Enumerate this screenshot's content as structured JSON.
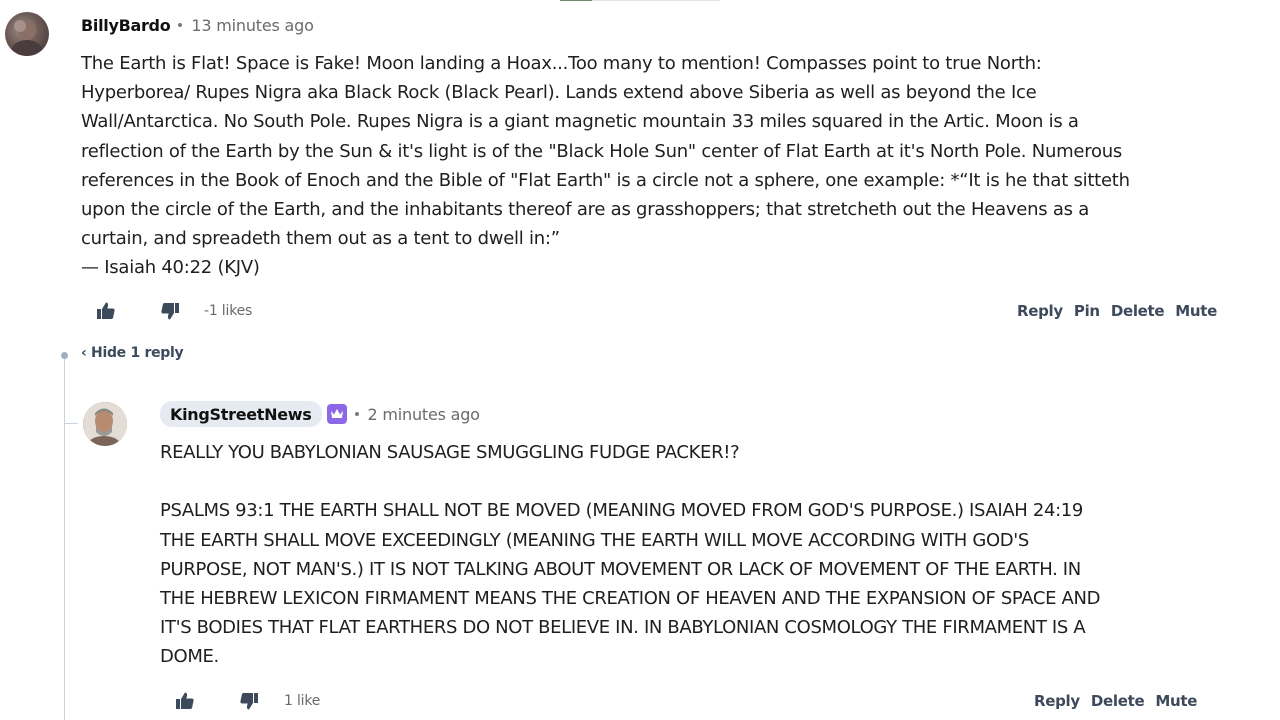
{
  "comments": [
    {
      "author": "BillyBardo",
      "time": "13 minutes ago",
      "body_lines": [
        "The Earth is Flat! Space is Fake! Moon landing a Hoax...Too many to mention! Compasses point to true North:",
        "Hyperborea/ Rupes Nigra aka Black Rock (Black Pearl). Lands extend above Siberia as well as beyond the Ice",
        "Wall/Antarctica. No South Pole. Rupes Nigra is a giant magnetic mountain 33 miles squared in the Artic. Moon is a",
        "reflection of the Earth by the Sun & it's light is of the \"Black Hole Sun\" center of Flat Earth at it's North Pole. Numerous",
        "references in the Book of Enoch and the Bible of \"Flat Earth\" is a circle not a sphere, one example: *“It is he that sitteth",
        "upon the circle of the Earth, and the inhabitants thereof are as grasshoppers; that stretcheth out the Heavens as a",
        "curtain, and spreadeth them out as a tent to dwell in:”",
        "— Isaiah 40:22 (KJV)"
      ],
      "likes": "-1 likes",
      "actions": [
        "Reply",
        "Pin",
        "Delete",
        "Mute"
      ]
    },
    {
      "author": "KingStreetNews",
      "time": "2 minutes ago",
      "badge_icon": "crown-icon",
      "badge_color": "#8c68e6",
      "body_lines": [
        "REALLY YOU BABYLONIAN SAUSAGE SMUGGLING FUDGE PACKER!?",
        "",
        "PSALMS 93:1 THE EARTH SHALL NOT BE MOVED (MEANING MOVED FROM GOD'S PURPOSE.) ISAIAH 24:19",
        "THE EARTH SHALL MOVE EXCEEDINGLY (MEANING THE EARTH WILL MOVE ACCORDING WITH GOD'S",
        "PURPOSE, NOT MAN'S.) IT IS NOT TALKING ABOUT MOVEMENT OR LACK OF MOVEMENT OF THE EARTH. IN",
        "THE HEBREW LEXICON FIRMAMENT MEANS THE CREATION OF HEAVEN AND THE EXPANSION OF SPACE AND",
        "IT'S BODIES THAT FLAT EARTHERS DO NOT BELIEVE IN. IN BABYLONIAN COSMOLOGY THE FIRMAMENT IS A",
        "DOME."
      ],
      "likes": "1 like",
      "actions": [
        "Reply",
        "Delete",
        "Mute"
      ]
    }
  ],
  "replies_toggle": "‹ Hide 1 reply",
  "colors": {
    "action_text": "#3d4a5c",
    "muted_text": "#6b6b6b",
    "thread_line": "#c9d3de",
    "author_pill": "#e6ebf1"
  }
}
